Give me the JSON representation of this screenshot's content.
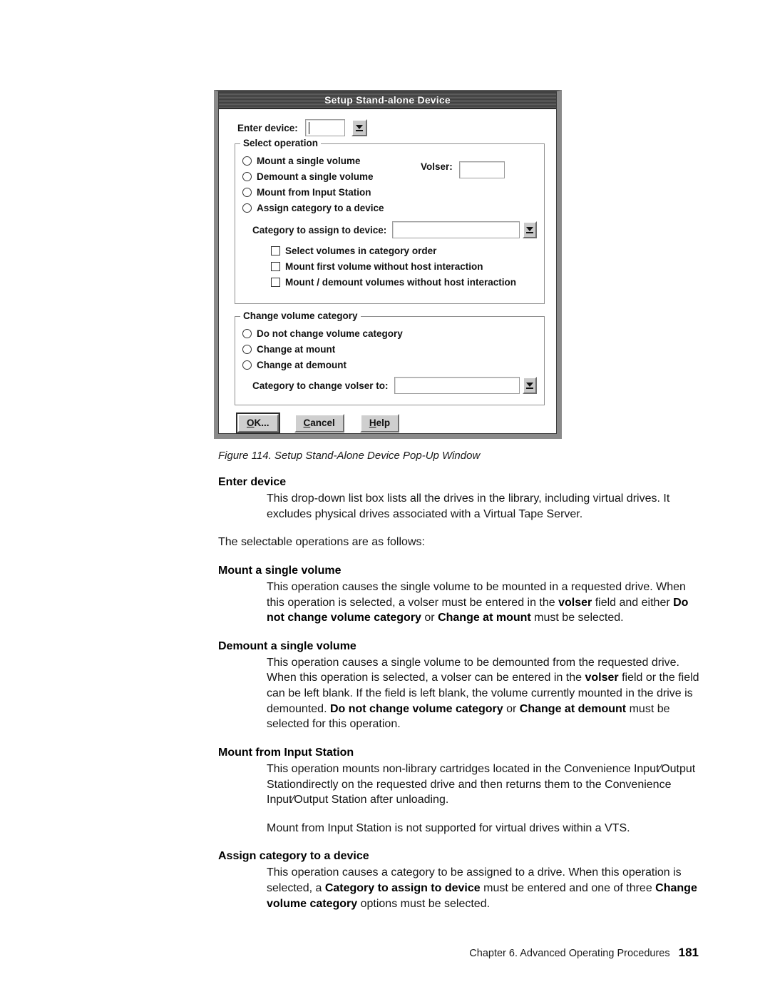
{
  "dialog": {
    "title": "Setup Stand-alone Device",
    "enter_device": {
      "label": "Enter device:",
      "value": "",
      "dropdown_icon": "chevron-down-icon"
    },
    "select_operation": {
      "group_title": "Select operation",
      "radios": [
        {
          "label": "Mount a single volume",
          "selected": false
        },
        {
          "label": "Demount a single volume",
          "selected": false
        },
        {
          "label": "Mount from Input Station",
          "selected": false
        },
        {
          "label": "Assign category to a device",
          "selected": false
        }
      ],
      "volser": {
        "label": "Volser:",
        "value": ""
      },
      "category_to_assign": {
        "label": "Category to assign to device:",
        "value": "",
        "dropdown_icon": "chevron-down-icon"
      },
      "checkboxes": [
        {
          "label": "Select volumes in category order",
          "checked": false
        },
        {
          "label": "Mount first volume without host interaction",
          "checked": false
        },
        {
          "label": "Mount / demount volumes without host interaction",
          "checked": false
        }
      ]
    },
    "change_volume_category": {
      "group_title": "Change volume category",
      "radios": [
        {
          "label": "Do not change volume category",
          "selected": false
        },
        {
          "label": "Change at mount",
          "selected": false
        },
        {
          "label": "Change at demount",
          "selected": false
        }
      ],
      "category_to_change": {
        "label": "Category to change volser to:",
        "value": "",
        "dropdown_icon": "chevron-down-icon"
      }
    },
    "buttons": [
      {
        "label_pre": "O",
        "label_mnemonic": "O",
        "label_rest": "K...",
        "full": "OK...",
        "default": true
      },
      {
        "label_mnemonic": "C",
        "label_rest": "ancel",
        "full": "Cancel",
        "default": false
      },
      {
        "label_mnemonic": "H",
        "label_rest": "elp",
        "full": "Help",
        "default": false
      }
    ]
  },
  "document": {
    "figure_caption": "Figure 114. Setup Stand-Alone Device Pop-Up Window",
    "sections": [
      {
        "term": "Enter device",
        "body_html": "This drop-down list box lists all the drives in the library, including virtual drives. It excludes physical drives associated with a Virtual Tape Server."
      }
    ],
    "intro_line": "The selectable operations are as follows:",
    "operations": [
      {
        "term": "Mount a single volume",
        "body_html": "This operation causes the single volume to be mounted in a requested drive. When this operation is selected, a volser must be entered in the <b>volser</b> field and either <b>Do not change volume category</b> or <b>Change at mount</b> must be selected."
      },
      {
        "term": "Demount a single volume",
        "body_html": "This operation causes a single volume to be demounted from the requested drive. When this operation is selected, a volser can be entered in the <b>volser</b> field or the field can be left blank. If the field is left blank, the volume currently mounted in the drive is demounted. <b>Do not change volume category</b> or <b>Change at demount</b> must be selected for this operation."
      },
      {
        "term": "Mount from Input Station",
        "body_html": "This operation mounts non-library cartridges located in the Convenience Input⁄Output Stationdirectly on the requested drive and then returns them to the Convenience Input⁄Output Station after unloading.",
        "extra_paragraph": "Mount from Input Station is not supported for virtual drives within a VTS."
      },
      {
        "term": "Assign category to a device",
        "body_html": "This operation causes a category to be assigned to a drive. When this operation is selected, a <b>Category to assign to device</b> must be entered and one of three <b>Change volume category</b> options must be selected."
      }
    ],
    "footer": {
      "chapter": "Chapter 6. Advanced Operating Procedures",
      "page_number": "181"
    }
  }
}
